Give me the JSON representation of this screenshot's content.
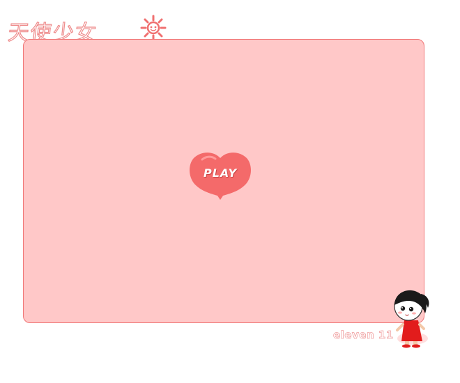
{
  "header": {
    "logo_text": "天使少女",
    "logo_icon": "sun-icon"
  },
  "game": {
    "play_label": "PLAY"
  },
  "footer": {
    "credit": "eleven 11",
    "mascot": "girl-mascot"
  },
  "colors": {
    "panel_fill": "#ffc8c8",
    "panel_border": "#f07676",
    "play_button": "#f46a6a",
    "logo_outline": "#ee8a8a"
  }
}
